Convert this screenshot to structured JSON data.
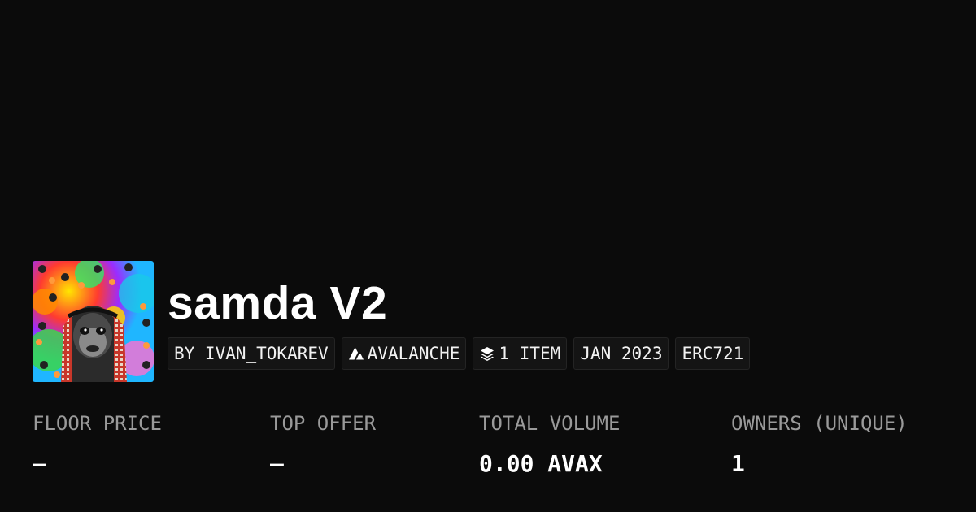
{
  "collection": {
    "name": "samda V2",
    "avatar_icon": "gorilla-in-keffiyeh-avatar"
  },
  "tags": {
    "creator": "BY IVAN_TOKAREV",
    "chain": "AVALANCHE",
    "chain_icon": "avalanche-icon",
    "items": "1 ITEM",
    "items_icon": "layers-icon",
    "date": "JAN 2023",
    "standard": "ERC721"
  },
  "stats": {
    "floor_label": "FLOOR PRICE",
    "floor_value": "—",
    "offer_label": "TOP OFFER",
    "offer_value": "—",
    "volume_label": "TOTAL VOLUME",
    "volume_value": "0.00 AVAX",
    "owners_label": "OWNERS (UNIQUE)",
    "owners_value": "1"
  },
  "colors": {
    "background": "#0b0b0b",
    "text": "#ffffff",
    "muted": "#9a9a9a",
    "tag_bg": "#141414"
  }
}
